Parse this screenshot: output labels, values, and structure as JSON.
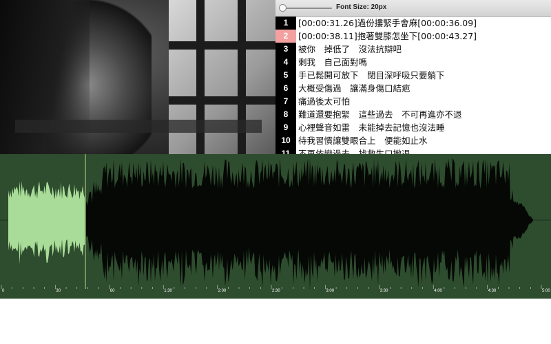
{
  "toolbar": {
    "font_size_label": "Font Size: 20px",
    "font_size_slider_fraction": 0.0
  },
  "lyrics": [
    {
      "num": "1",
      "text": "[00:00:31.26]過份摟緊手會麻[00:00:36.09]"
    },
    {
      "num": "2",
      "text": "[00:00:38.11]抱著雙膝怎坐下[00:00:43.27]",
      "selected": true
    },
    {
      "num": "3",
      "text": "被你　掉低了　沒法抗辯吧"
    },
    {
      "num": "4",
      "text": "剩我　自己面對嗎"
    },
    {
      "num": "5",
      "text": "手已鬆開可放下　閉目深呼吸只要躺下"
    },
    {
      "num": "6",
      "text": "大概受傷過　讓滿身傷口結疤"
    },
    {
      "num": "7",
      "text": "痛過後太可怕"
    },
    {
      "num": "8",
      "text": "難道還要抱緊　這些過去　不可再進亦不退"
    },
    {
      "num": "9",
      "text": "心裡聲音如雷　未能掉去記憶也沒法睡"
    },
    {
      "num": "10",
      "text": "待我習慣讓雙眼合上　便能如止水"
    },
    {
      "num": "11",
      "text": "不再依戀過去　找救生口撤退"
    }
  ],
  "timeline": {
    "ticks": [
      "0",
      "30",
      "60",
      "1:30",
      "2:00",
      "2:30",
      "3:00",
      "3:30",
      "4:00",
      "4:30",
      "5:00"
    ],
    "played_fraction": 0.145
  },
  "colors": {
    "waveform_bg": "#2e4c2e",
    "waveform_fill": "#050805",
    "waveform_played": "#a8dc98",
    "playhead": "#8fa86a",
    "selected_line": "#f4a0a0"
  }
}
